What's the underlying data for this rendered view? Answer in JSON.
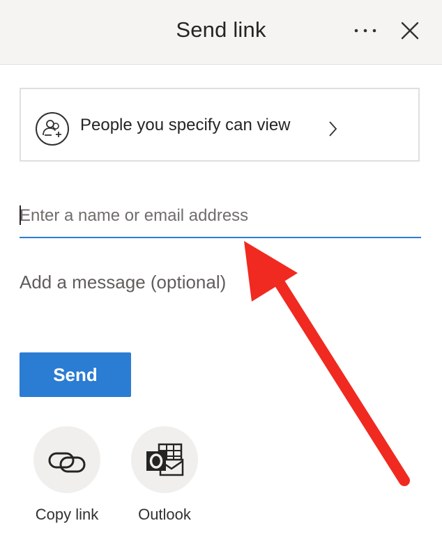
{
  "header": {
    "title": "Send link",
    "more_icon": "ellipsis-icon",
    "close_icon": "close-icon"
  },
  "permission": {
    "label": "People you specify can view",
    "icon": "people-icon",
    "chevron_icon": "chevron-right-icon"
  },
  "recipient": {
    "placeholder": "Enter a name or email address",
    "value": ""
  },
  "message": {
    "placeholder": "Add a message (optional)",
    "value": ""
  },
  "send_button": {
    "label": "Send"
  },
  "share_options": [
    {
      "label": "Copy link",
      "icon": "link-icon"
    },
    {
      "label": "Outlook",
      "icon": "outlook-icon"
    }
  ],
  "annotation": {
    "arrow_color": "#f02a20"
  },
  "colors": {
    "accent": "#2b7cd3",
    "header_bg": "#f5f4f2",
    "text": "#252423"
  }
}
